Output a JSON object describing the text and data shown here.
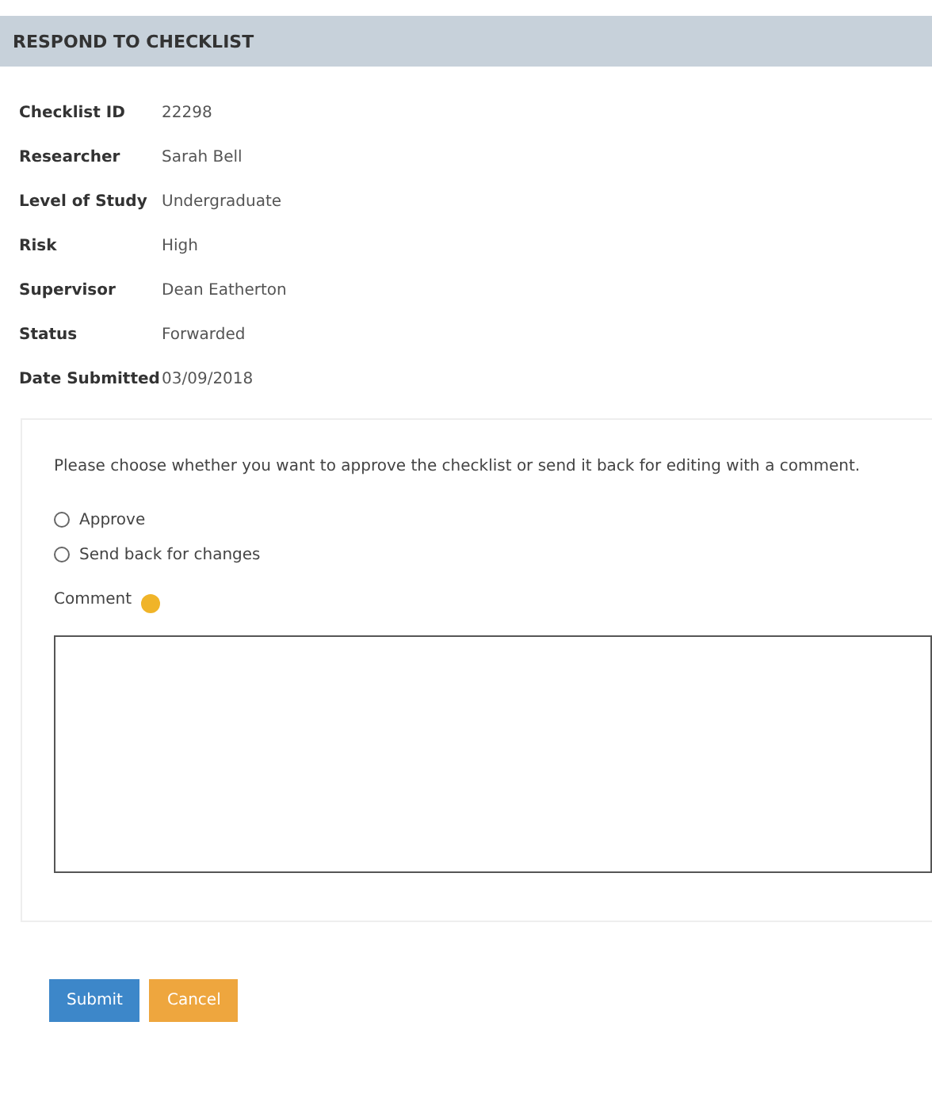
{
  "header": {
    "title": "RESPOND TO CHECKLIST"
  },
  "details": [
    {
      "label": "Checklist ID",
      "value": "22298"
    },
    {
      "label": "Researcher",
      "value": "Sarah Bell"
    },
    {
      "label": "Level of Study",
      "value": "Undergraduate"
    },
    {
      "label": "Risk",
      "value": "High"
    },
    {
      "label": "Supervisor",
      "value": "Dean Eatherton"
    },
    {
      "label": "Status",
      "value": "Forwarded"
    },
    {
      "label": "Date Submitted",
      "value": "03/09/2018"
    }
  ],
  "form": {
    "instructions": "Please choose whether you want to approve the checklist or send it back for editing with a comment.",
    "options": [
      {
        "label": "Approve",
        "selected": false
      },
      {
        "label": "Send back for changes",
        "selected": false
      }
    ],
    "comment_label": "Comment"
  },
  "buttons": [
    {
      "label": "Submit",
      "kind": "primary"
    },
    {
      "label": "Cancel",
      "kind": "warning"
    }
  ]
}
